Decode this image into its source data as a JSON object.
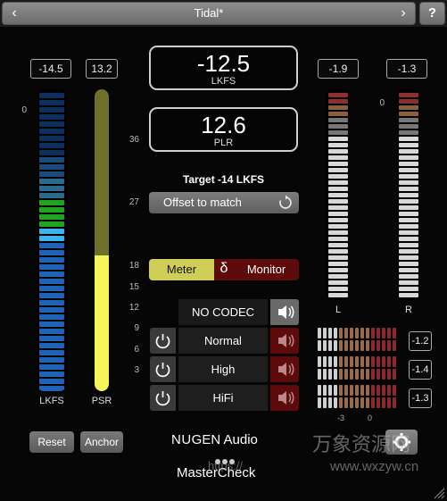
{
  "header": {
    "preset_name": "Tidal*",
    "prev_icon": "‹",
    "next_icon": "›",
    "help_label": "?"
  },
  "left_meters": {
    "lkfs_value": "-14.5",
    "psr_value": "13.2",
    "lkfs_label": "LKFS",
    "psr_label": "PSR",
    "psr_level": 0.55,
    "scale_zero": "0",
    "scale": [
      "36",
      "27",
      "18",
      "15",
      "12",
      "9",
      "6",
      "3"
    ]
  },
  "readouts": {
    "loudness_value": "-12.5",
    "loudness_unit": "LKFS",
    "plr_value": "12.6",
    "plr_unit": "PLR"
  },
  "target": {
    "label": "Target -14 LKFS",
    "offset_button": "Offset to match"
  },
  "mode_toggle": {
    "meter_label": "Meter",
    "delta_label": "δ",
    "monitor_label": "Monitor"
  },
  "codecs": [
    {
      "label": "NO CODEC",
      "active": true
    },
    {
      "label": "Normal",
      "active": false
    },
    {
      "label": "High",
      "active": false
    },
    {
      "label": "HiFi",
      "active": false
    }
  ],
  "right_meters": {
    "l_value": "-1.9",
    "r_value": "-1.3",
    "l_label": "L",
    "r_label": "R",
    "scale_zero": "0",
    "codec_peaks": [
      "-1.2",
      "-1.4",
      "-1.3"
    ],
    "mini_scale": [
      "-3",
      "0"
    ]
  },
  "footer": {
    "reset_label": "Reset",
    "anchor_label": "Anchor",
    "brand_nu": "NU",
    "brand_rest": "GEN Audio",
    "product": "MasterCheck"
  },
  "watermark": {
    "chinese": "万象资源网",
    "url": "www.wxzyw.cn",
    "prefix": "https://"
  },
  "colors": {
    "psr_yellow": "#f5f55a",
    "psr_olive": "#6f6f2c",
    "lkfs_blue": "#1f63b8",
    "lkfs_green": "#1fa51f",
    "monitor_red": "#5e0b0b",
    "meter_toggle_yellow": "#cfcf57"
  }
}
